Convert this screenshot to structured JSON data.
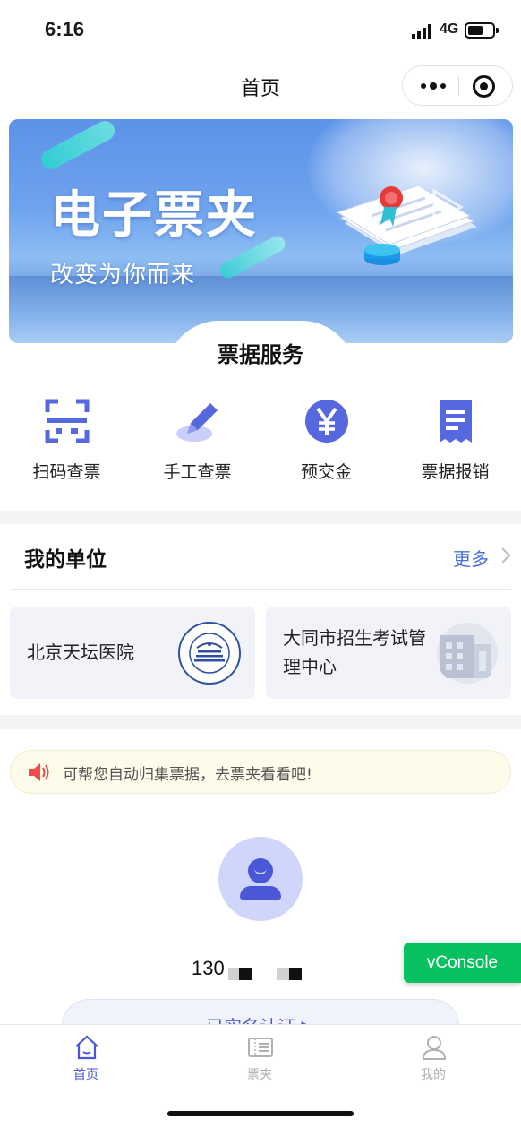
{
  "status_bar": {
    "time": "6:16",
    "network": "4G"
  },
  "header": {
    "title": "首页"
  },
  "banner": {
    "title": "电子票夹",
    "subtitle": "改变为你而来"
  },
  "service": {
    "title": "票据服务",
    "items": [
      {
        "label": "扫码查票",
        "icon": "scan-icon"
      },
      {
        "label": "手工查票",
        "icon": "pen-icon"
      },
      {
        "label": "预交金",
        "icon": "yuan-icon"
      },
      {
        "label": "票据报销",
        "icon": "receipt-icon"
      }
    ]
  },
  "units": {
    "title": "我的单位",
    "more": "更多",
    "cards": [
      {
        "name": "北京天坛医院",
        "logo": "hospital-seal-logo"
      },
      {
        "name_line1": "大同市招生考试管",
        "name_line2": "理中心",
        "logo": "building-icon"
      }
    ]
  },
  "tip": {
    "text": "可帮您自动归集票据，去票夹看看吧!"
  },
  "profile": {
    "phone_prefix": "130",
    "verify_label": "已实名认证 ▶"
  },
  "vconsole": {
    "label": "vConsole"
  },
  "tabbar": {
    "items": [
      {
        "label": "首页",
        "icon": "home-icon",
        "active": true
      },
      {
        "label": "票夹",
        "icon": "ticket-folder-icon",
        "active": false
      },
      {
        "label": "我的",
        "icon": "user-icon",
        "active": false
      }
    ]
  },
  "colors": {
    "accent": "#4a57d6",
    "vconsole": "#07c160",
    "tip_bg": "#fdfbea",
    "card_bg": "#f1f3f9"
  }
}
